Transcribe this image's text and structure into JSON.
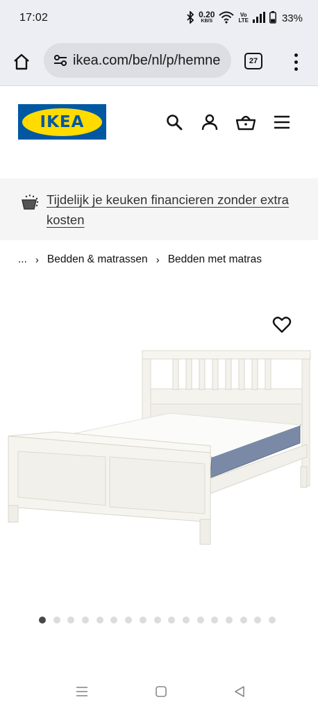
{
  "status_bar": {
    "time": "17:02",
    "net_speed_value": "0.20",
    "net_speed_unit": "KB/S",
    "volte_top": "Vo",
    "volte_bottom": "LTE",
    "battery_percent": "33%",
    "icons": [
      "bluetooth-icon",
      "wifi-icon",
      "signal-icon",
      "battery-icon"
    ]
  },
  "browser": {
    "url": "ikea.com/be/nl/p/hemne",
    "tab_count": "27",
    "icons": [
      "home-icon",
      "site-settings-icon",
      "tabs-icon",
      "more-menu-icon"
    ]
  },
  "header": {
    "logo_text": "IKEA",
    "brand_colors": {
      "blue": "#0058a3",
      "yellow": "#ffdb00"
    },
    "icons": [
      "search-icon",
      "account-icon",
      "basket-icon",
      "hamburger-menu-icon"
    ]
  },
  "promo": {
    "text": "Tijdelijk je keuken financieren zonder extra kosten",
    "icon": "financing-icon"
  },
  "breadcrumb": {
    "items": [
      "...",
      "Bedden & matrassen",
      "Bedden met matras"
    ]
  },
  "gallery": {
    "favorite_icon": "heart-icon",
    "image_subject": "white wooden bed frame with mattress",
    "image_count": 17,
    "active_index": 0
  },
  "android_nav": {
    "icons": [
      "recent-apps-icon",
      "home-button-icon",
      "back-icon"
    ]
  }
}
